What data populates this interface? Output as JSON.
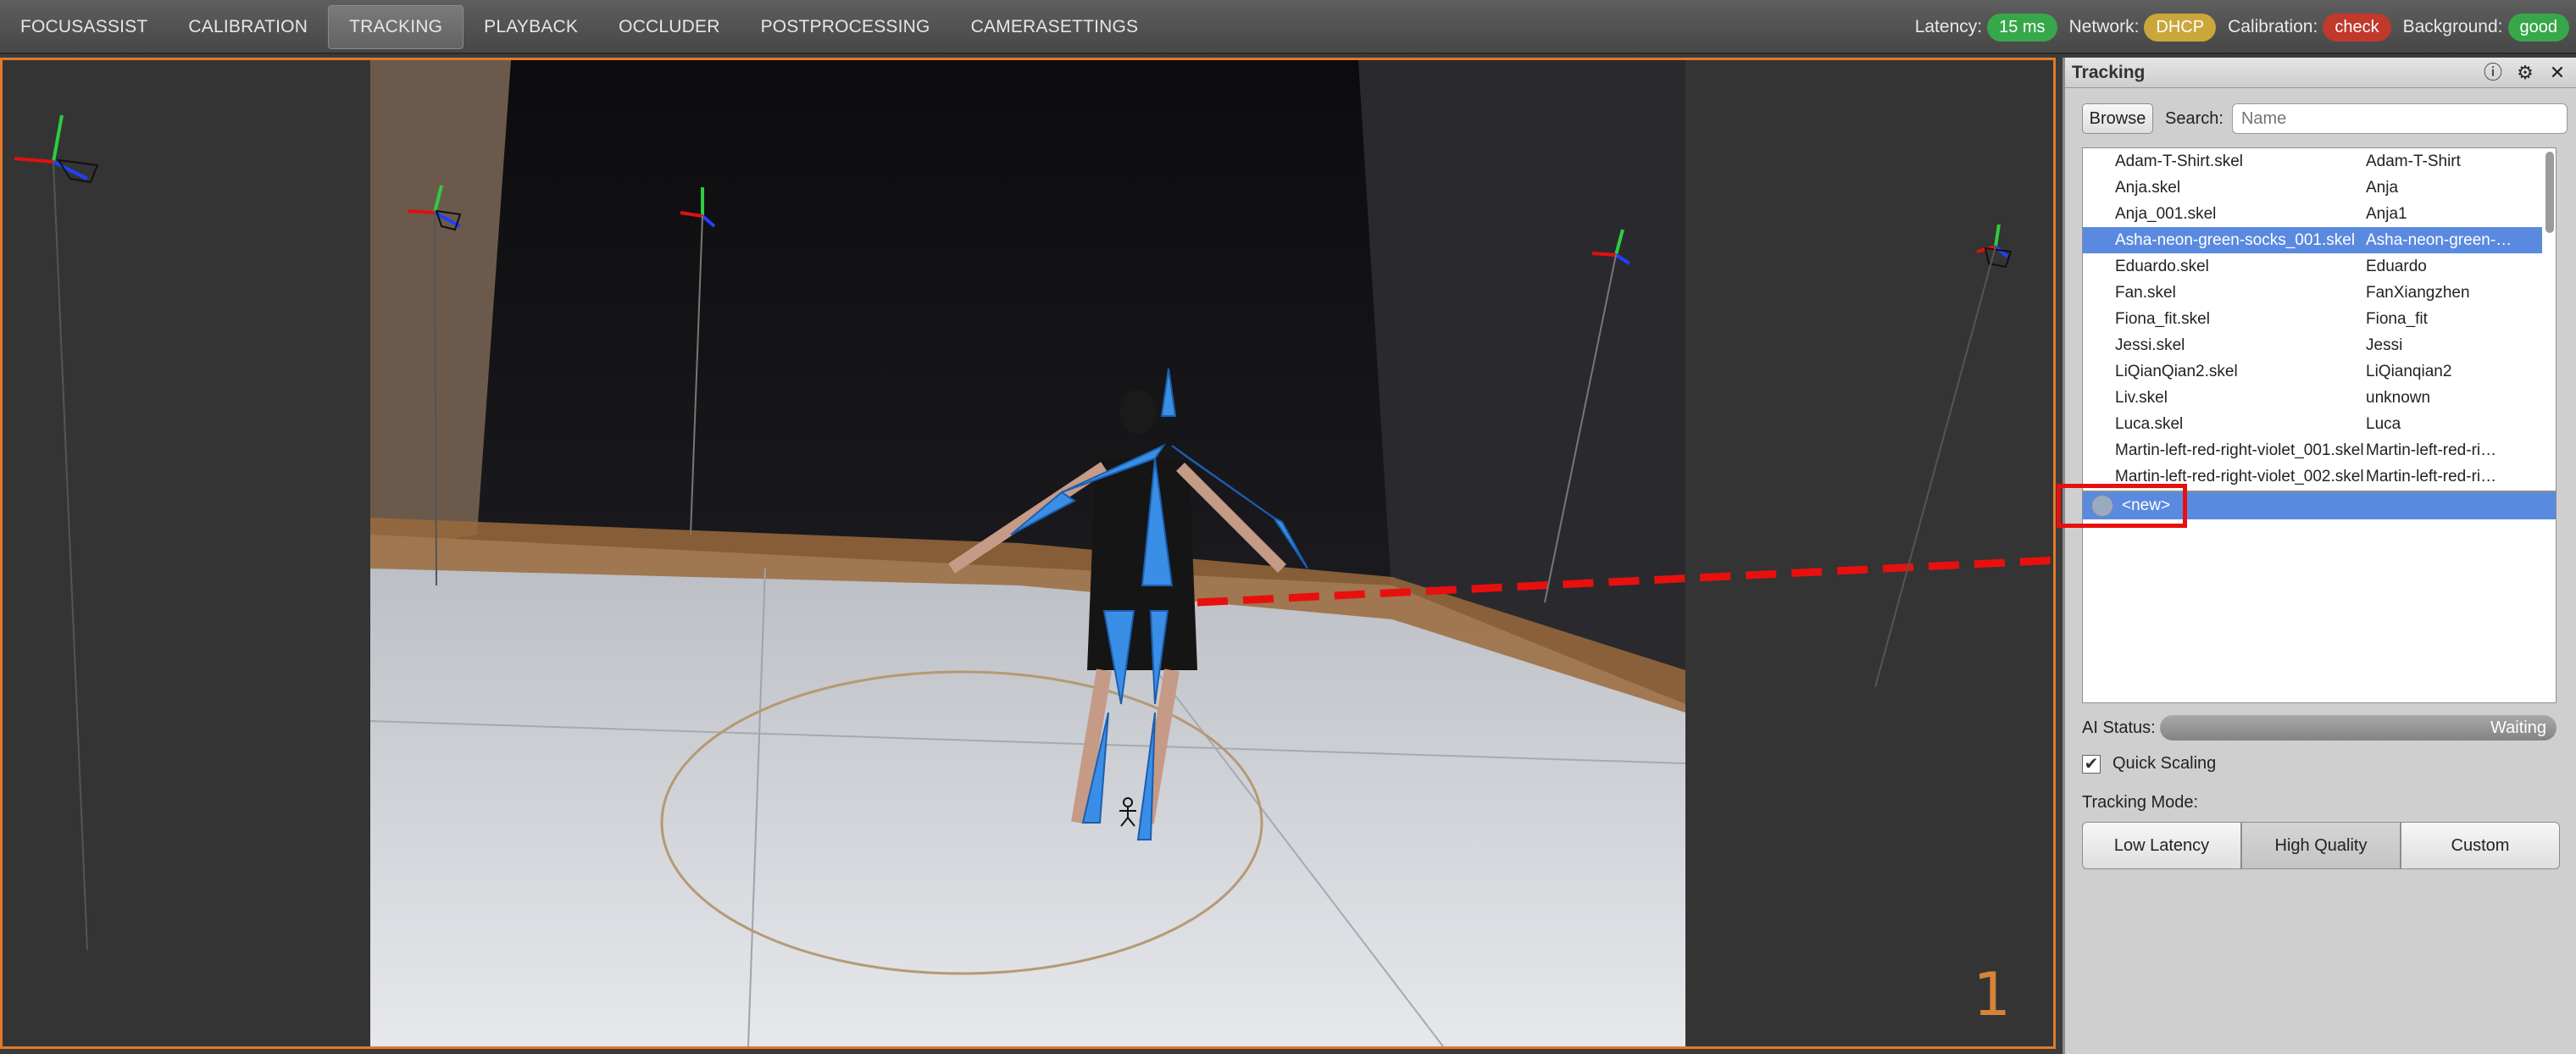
{
  "topbar": {
    "tabs": [
      {
        "label": "FOCUSASSIST",
        "active": false
      },
      {
        "label": "CALIBRATION",
        "active": false
      },
      {
        "label": "TRACKING",
        "active": true
      },
      {
        "label": "PLAYBACK",
        "active": false
      },
      {
        "label": "OCCLUDER",
        "active": false
      },
      {
        "label": "POSTPROCESSING",
        "active": false
      },
      {
        "label": "CAMERASETTINGS",
        "active": false
      }
    ],
    "status": {
      "latency_label": "Latency:",
      "latency_value": "15 ms",
      "network_label": "Network:",
      "network_value": "DHCP",
      "calibration_label": "Calibration:",
      "calibration_value": "check",
      "background_label": "Background:",
      "background_value": "good"
    },
    "colors": {
      "good": "#36a84a",
      "warn": "#c9a73a",
      "bad": "#c0392b"
    }
  },
  "viewport": {
    "camera_number": "1",
    "accent_color": "#e07a2a"
  },
  "panel": {
    "title": "Tracking",
    "icons": [
      "info-icon",
      "gear-icon",
      "close-icon"
    ],
    "browse_label": "Browse",
    "search_label": "Search:",
    "search_placeholder": "Name",
    "skeletons": [
      {
        "file": "Adam-T-Shirt.skel",
        "name": "Adam-T-Shirt"
      },
      {
        "file": "Anja.skel",
        "name": "Anja"
      },
      {
        "file": "Anja_001.skel",
        "name": "Anja1"
      },
      {
        "file": "Asha-neon-green-socks_001.skel",
        "name": "Asha-neon-green-…"
      },
      {
        "file": "Eduardo.skel",
        "name": "Eduardo"
      },
      {
        "file": "Fan.skel",
        "name": "FanXiangzhen"
      },
      {
        "file": "Fiona_fit.skel",
        "name": "Fiona_fit"
      },
      {
        "file": "Jessi.skel",
        "name": "Jessi"
      },
      {
        "file": "LiQianQian2.skel",
        "name": "LiQianqian2"
      },
      {
        "file": "Liv.skel",
        "name": "unknown"
      },
      {
        "file": "Luca.skel",
        "name": "Luca"
      },
      {
        "file": "Martin-left-red-right-violet_001.skel",
        "name": "Martin-left-red-ri…"
      },
      {
        "file": "Martin-left-red-right-violet_002.skel",
        "name": "Martin-left-red-ri…"
      }
    ],
    "selected_index": 3,
    "new_entry": "<new>",
    "ai_status_label": "AI Status:",
    "ai_status_value": "Waiting",
    "quick_scaling_label": "Quick Scaling",
    "quick_scaling_checked": true,
    "tracking_mode_label": "Tracking Mode:",
    "modes": [
      "Low Latency",
      "High Quality",
      "Custom"
    ],
    "active_mode": "High Quality"
  }
}
